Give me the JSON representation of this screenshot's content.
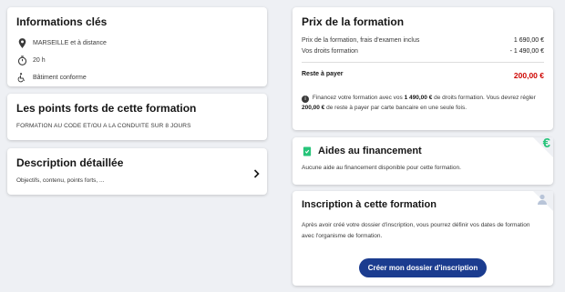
{
  "infos": {
    "title": "Informations clés",
    "location": "MARSEILLE et à distance",
    "duration": "20 h",
    "accessibility": "Bâtiment conforme"
  },
  "points_forts": {
    "title": "Les points forts de cette formation",
    "text": "FORMATION AU CODE ET/OU A LA CONDUITE SUR 8 JOURS"
  },
  "description": {
    "title": "Description détaillée",
    "text": "Objectifs, contenu, points forts, ..."
  },
  "prix": {
    "title": "Prix de la formation",
    "line1_label": "Prix de la formation, frais d'examen inclus",
    "line1_value": "1 690,00 €",
    "line2_label": "Vos droits formation",
    "line2_value": "- 1 490,00 €",
    "reste_label": "Reste à payer",
    "reste_value": "200,00 €",
    "note_prefix": "Financez votre formation avec vos ",
    "note_droits": "1 490,00 €",
    "note_mid": " de droits formation. Vous devrez régler ",
    "note_reste": "200,00 €",
    "note_suffix": " de reste à payer par carte bancaire en une seule fois."
  },
  "aides": {
    "title": "Aides au financement",
    "text": "Aucune aide au financement disponible pour cette formation.",
    "corner_symbol": "€"
  },
  "inscription": {
    "title": "Inscription à cette formation",
    "text": "Après avoir créé votre dossier d'inscription, vous pourrez définir vos dates de formation avec l'organisme de formation.",
    "button_label": "Créer mon dossier d'inscription"
  },
  "colors": {
    "brand_blue": "#1b3c8f",
    "price_red": "#ce0500",
    "euro_green": "#27c47a"
  }
}
